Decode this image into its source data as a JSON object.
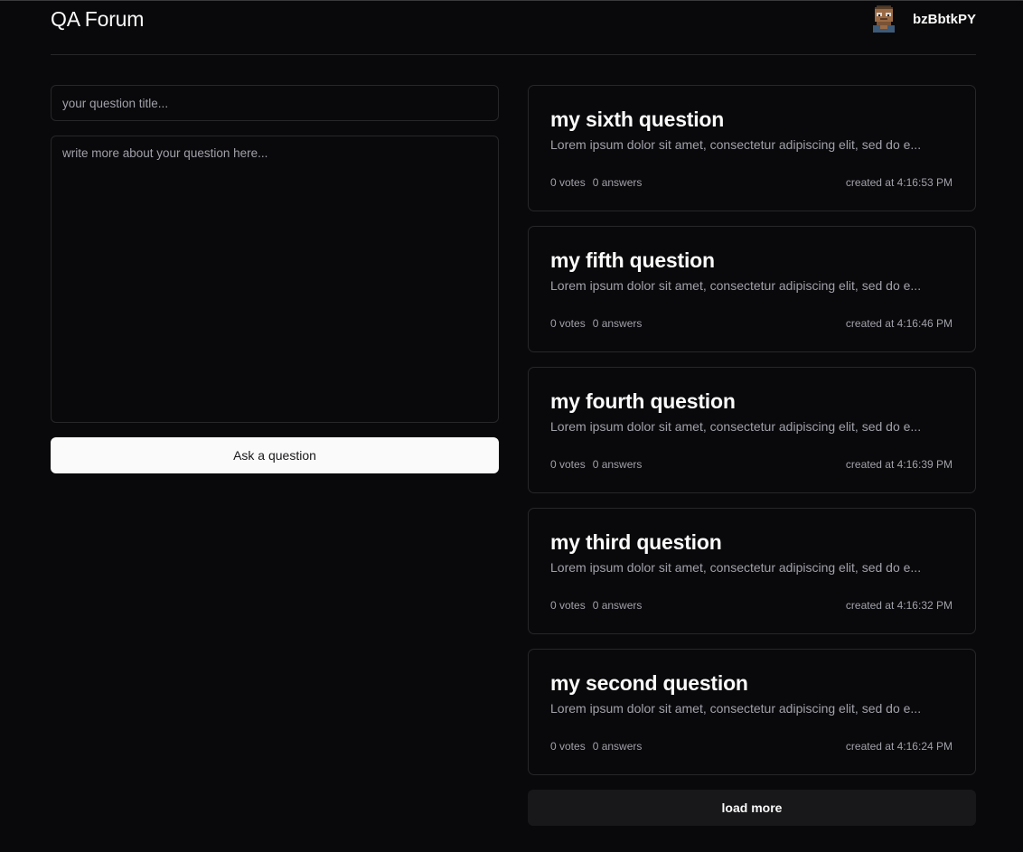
{
  "header": {
    "title": "QA Forum",
    "username": "bzBbtkPY",
    "avatar_icon": "pixel-avatar-icon"
  },
  "ask_form": {
    "title_placeholder": "your question title...",
    "body_placeholder": "write more about your question here...",
    "submit_label": "Ask a question"
  },
  "questions": [
    {
      "title": "my sixth question",
      "excerpt": "Lorem ipsum dolor sit amet, consectetur adipiscing elit, sed do e...",
      "votes": "0 votes",
      "answers": "0 answers",
      "created": "created at 4:16:53 PM"
    },
    {
      "title": "my fifth question",
      "excerpt": "Lorem ipsum dolor sit amet, consectetur adipiscing elit, sed do e...",
      "votes": "0 votes",
      "answers": "0 answers",
      "created": "created at 4:16:46 PM"
    },
    {
      "title": "my fourth question",
      "excerpt": "Lorem ipsum dolor sit amet, consectetur adipiscing elit, sed do e...",
      "votes": "0 votes",
      "answers": "0 answers",
      "created": "created at 4:16:39 PM"
    },
    {
      "title": "my third question",
      "excerpt": "Lorem ipsum dolor sit amet, consectetur adipiscing elit, sed do e...",
      "votes": "0 votes",
      "answers": "0 answers",
      "created": "created at 4:16:32 PM"
    },
    {
      "title": "my second question",
      "excerpt": "Lorem ipsum dolor sit amet, consectetur adipiscing elit, sed do e...",
      "votes": "0 votes",
      "answers": "0 answers",
      "created": "created at 4:16:24 PM"
    }
  ],
  "load_more_label": "load more",
  "colors": {
    "background": "#09090b",
    "border": "#27272a",
    "muted_text": "#a1a1aa",
    "primary_button": "#fafafa",
    "secondary_button": "#18181b"
  }
}
